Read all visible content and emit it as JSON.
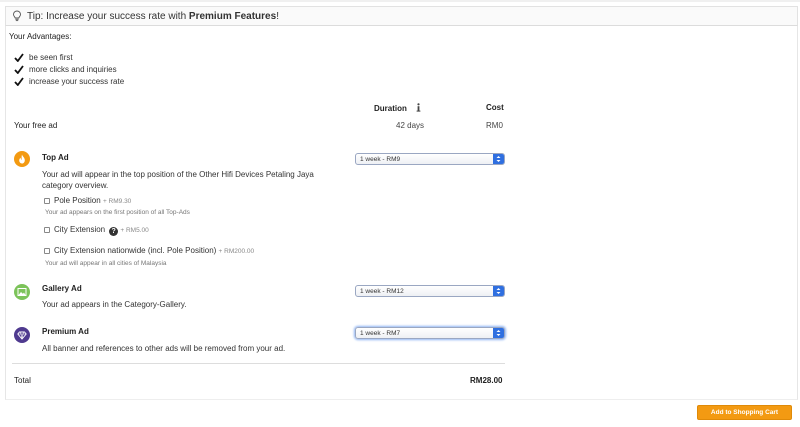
{
  "tip": {
    "prefix": "Tip: Increase your success rate with ",
    "highlight": "Premium Features",
    "suffix": "!"
  },
  "advantages": {
    "title": "Your Advantages:",
    "items": [
      "be seen first",
      "more clicks and inquiries",
      "increase your success rate"
    ]
  },
  "columns": {
    "duration": "Duration",
    "cost": "Cost"
  },
  "free_ad": {
    "label": "Your free ad",
    "duration": "42 days",
    "cost": "RM0"
  },
  "top_ad": {
    "title": "Top Ad",
    "description": "Your ad will appear in the top position of the Other Hifi Devices Petaling Jaya category overview.",
    "select_value": "1 week - RM9",
    "options": [
      {
        "label": "Pole Position",
        "price": "+ RM9.30",
        "note": "Your ad appears on the first position of all Top-Ads"
      },
      {
        "label": "City Extension",
        "price": "+ RM5.00",
        "note": ""
      },
      {
        "label": "City Extension nationwide (incl. Pole Position)",
        "price": "+ RM200.00",
        "note": "Your ad will appear in all cities of Malaysia"
      }
    ],
    "icon_color": "#f39a12"
  },
  "gallery_ad": {
    "title": "Gallery Ad",
    "description": "Your ad appears in the Category-Gallery.",
    "select_value": "1 week - RM12",
    "icon_color": "#7cc35a"
  },
  "premium_ad": {
    "title": "Premium Ad",
    "description": "All banner and references to other ads will be removed from your ad.",
    "select_value": "1 week - RM7",
    "icon_color": "#4f3a8f"
  },
  "total": {
    "label": "Total",
    "value": "RM28.00"
  },
  "cart_button": {
    "label": "Add to Shopping Cart",
    "color": "#f39a12"
  }
}
